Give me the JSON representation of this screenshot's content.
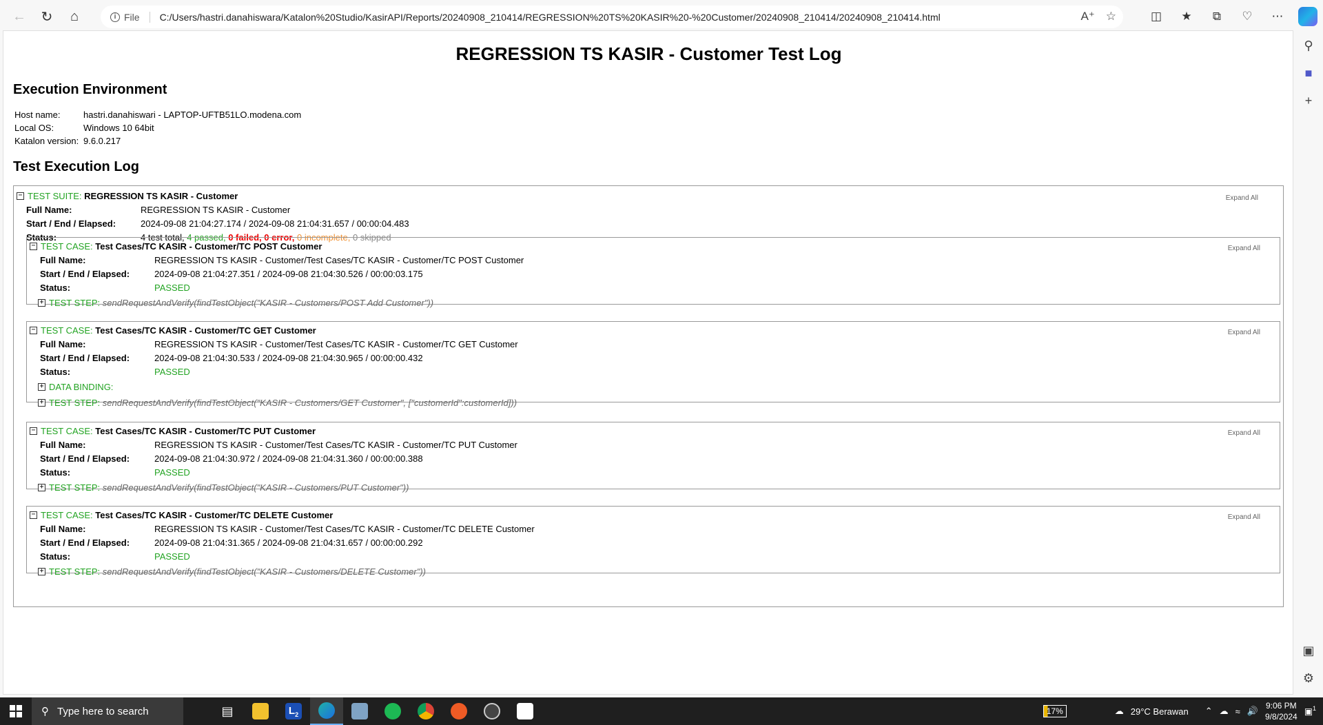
{
  "browser": {
    "url_label": "File",
    "url": "C:/Users/hastri.danahiswara/Katalon%20Studio/KasirAPI/Reports/20240908_210414/REGRESSION%20TS%20KASIR%20-%20Customer/20240908_210414/20240908_210414.html"
  },
  "report": {
    "title": "REGRESSION TS KASIR - Customer Test Log",
    "env_heading": "Execution Environment",
    "env": [
      {
        "key": "Host name:",
        "value": "hastri.danahiswari - LAPTOP-UFTB51LO.modena.com"
      },
      {
        "key": "Local OS:",
        "value": "Windows 10 64bit"
      },
      {
        "key": "Katalon version:",
        "value": "9.6.0.217"
      }
    ],
    "log_heading": "Test Execution Log",
    "expand_all": "Expand All",
    "labels": {
      "full_name": "Full Name:",
      "start_end": "Start / End / Elapsed:",
      "status": "Status:"
    },
    "suite": {
      "type": "TEST SUITE:",
      "name": "REGRESSION TS KASIR - Customer",
      "full_name": "REGRESSION TS KASIR - Customer",
      "timing": "2024-09-08 21:04:27.174 / 2024-09-08 21:04:31.657 / 00:00:04.483",
      "status_total": "4 test total,",
      "status_passed": "4 passed,",
      "status_failed": "0 failed,",
      "status_error": "0 error,",
      "status_incomplete": "0 incomplete,",
      "status_skipped": "0 skipped"
    },
    "cases": [
      {
        "type": "TEST CASE:",
        "name": "Test Cases/TC KASIR - Customer/TC POST Customer",
        "full_name": "REGRESSION TS KASIR - Customer/Test Cases/TC KASIR - Customer/TC POST Customer",
        "timing": "2024-09-08 21:04:27.351 / 2024-09-08 21:04:30.526 / 00:00:03.175",
        "status": "PASSED",
        "step_label": "TEST STEP:",
        "step": "sendRequestAndVerify(findTestObject(\"KASIR - Customers/POST Add Customer\"))"
      },
      {
        "type": "TEST CASE:",
        "name": "Test Cases/TC KASIR - Customer/TC GET Customer",
        "full_name": "REGRESSION TS KASIR - Customer/Test Cases/TC KASIR - Customer/TC GET Customer",
        "timing": "2024-09-08 21:04:30.533 / 2024-09-08 21:04:30.965 / 00:00:00.432",
        "status": "PASSED",
        "binding_label": "DATA BINDING:",
        "step_label": "TEST STEP:",
        "step": "sendRequestAndVerify(findTestObject(\"KASIR - Customers/GET Customer\", [\"customerId\":customerId]))"
      },
      {
        "type": "TEST CASE:",
        "name": "Test Cases/TC KASIR - Customer/TC PUT Customer",
        "full_name": "REGRESSION TS KASIR - Customer/Test Cases/TC KASIR - Customer/TC PUT Customer",
        "timing": "2024-09-08 21:04:30.972 / 2024-09-08 21:04:31.360 / 00:00:00.388",
        "status": "PASSED",
        "step_label": "TEST STEP:",
        "step": "sendRequestAndVerify(findTestObject(\"KASIR - Customers/PUT Customer\"))"
      },
      {
        "type": "TEST CASE:",
        "name": "Test Cases/TC KASIR - Customer/TC DELETE Customer",
        "full_name": "REGRESSION TS KASIR - Customer/Test Cases/TC KASIR - Customer/TC DELETE Customer",
        "timing": "2024-09-08 21:04:31.365 / 2024-09-08 21:04:31.657 / 00:00:00.292",
        "status": "PASSED",
        "step_label": "TEST STEP:",
        "step": "sendRequestAndVerify(findTestObject(\"KASIR - Customers/DELETE Customer\"))"
      }
    ]
  },
  "taskbar": {
    "search_placeholder": "Type here to search",
    "l_badge": "L",
    "l_count": "2",
    "battery": "17%",
    "weather": "29°C  Berawan",
    "time": "9:06 PM",
    "date": "9/8/2024",
    "notif_count": "1"
  }
}
